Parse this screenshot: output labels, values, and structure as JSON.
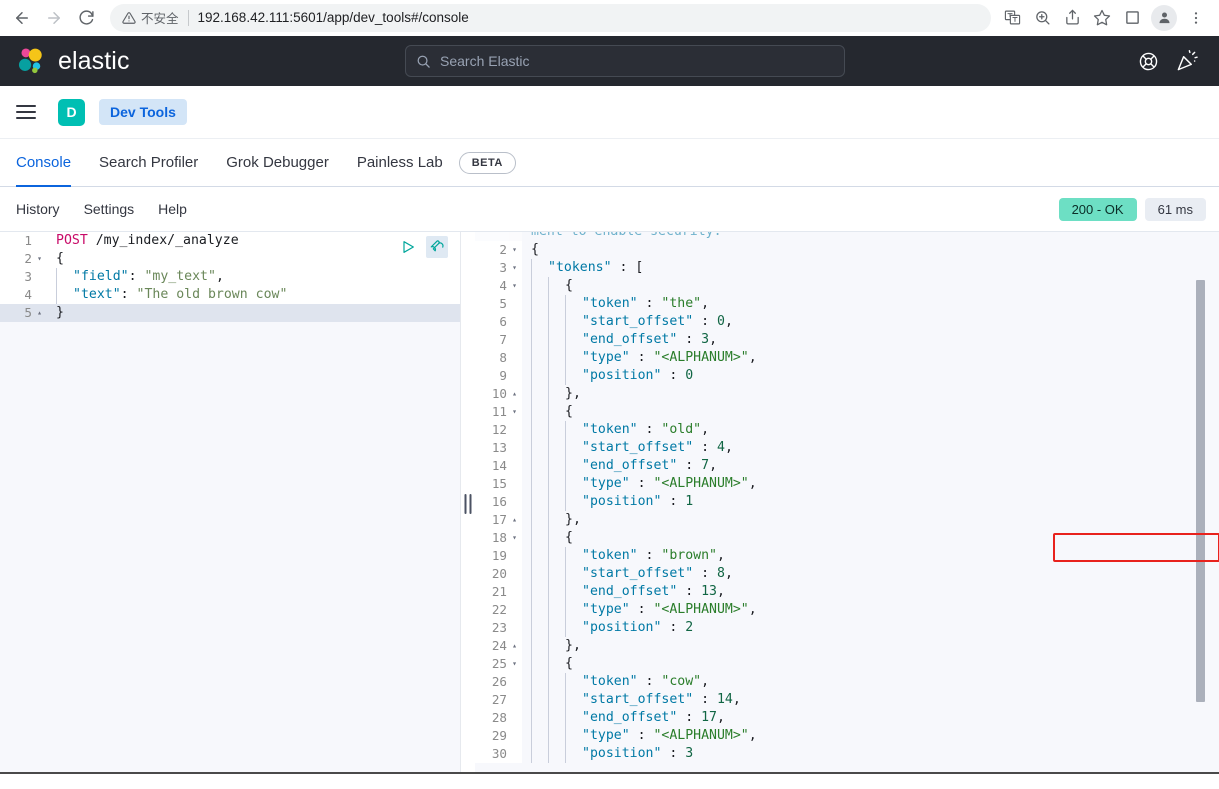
{
  "browser": {
    "back_label": "Back",
    "forward_label": "Forward",
    "reload_label": "Reload",
    "security_warning": "不安全",
    "url": "192.168.42.111:5601/app/dev_tools#/console",
    "toolbar_icons": [
      "translate-icon",
      "zoom-icon",
      "share-icon",
      "bookmark-star-icon",
      "sidepanel-icon",
      "profile-avatar-icon",
      "chrome-menu-icon"
    ]
  },
  "header": {
    "brand": "elastic",
    "search_placeholder": "Search Elastic",
    "search_icon": "search-icon",
    "help_icon": "help-lifebuoy-icon",
    "whats_new_icon": "announcement-megaphone-icon"
  },
  "breadcrumb": {
    "menu_icon": "hamburger-menu-icon",
    "space_initial": "D",
    "crumb": "Dev Tools"
  },
  "tabs": [
    {
      "label": "Console",
      "active": true
    },
    {
      "label": "Search Profiler",
      "active": false
    },
    {
      "label": "Grok Debugger",
      "active": false
    },
    {
      "label": "Painless Lab",
      "active": false
    }
  ],
  "beta_badge": "BETA",
  "console_toolbar": {
    "links": [
      "History",
      "Settings",
      "Help"
    ],
    "status": "200 - OK",
    "time": "61 ms"
  },
  "editor_actions": {
    "send_label": "Send request",
    "wrench_label": "Open documentation / actions"
  },
  "request_editor": {
    "lines": [
      {
        "n": "1",
        "fold": "",
        "active": false,
        "tokens": [
          {
            "t": "method",
            "v": "POST"
          },
          {
            "t": "plain",
            "v": " "
          },
          {
            "t": "url",
            "v": "/my_index/_analyze"
          }
        ]
      },
      {
        "n": "2",
        "fold": "▾",
        "active": false,
        "tokens": [
          {
            "t": "punct",
            "v": "{"
          }
        ]
      },
      {
        "n": "3",
        "fold": "",
        "active": false,
        "indent": 1,
        "tokens": [
          {
            "t": "key",
            "v": "\"field\""
          },
          {
            "t": "punct",
            "v": ": "
          },
          {
            "t": "str",
            "v": "\"my_text\""
          },
          {
            "t": "punct",
            "v": ","
          }
        ]
      },
      {
        "n": "4",
        "fold": "",
        "active": false,
        "indent": 1,
        "tokens": [
          {
            "t": "key",
            "v": "\"text\""
          },
          {
            "t": "punct",
            "v": ": "
          },
          {
            "t": "str",
            "v": "\"The old brown cow\""
          }
        ]
      },
      {
        "n": "5",
        "fold": "▴",
        "active": true,
        "tokens": [
          {
            "t": "punct",
            "v": "}"
          }
        ]
      }
    ]
  },
  "response_editor": {
    "truncated_top_text": "ment to enable security.",
    "lines": [
      {
        "n": "2",
        "fold": "▾",
        "tokens": [
          {
            "t": "punct",
            "v": "{"
          }
        ]
      },
      {
        "n": "3",
        "fold": "▾",
        "indent": 1,
        "tokens": [
          {
            "t": "key",
            "v": "\"tokens\""
          },
          {
            "t": "punct",
            "v": " : ["
          }
        ]
      },
      {
        "n": "4",
        "fold": "▾",
        "indent": 2,
        "tokens": [
          {
            "t": "punct",
            "v": "{"
          }
        ]
      },
      {
        "n": "5",
        "fold": "",
        "indent": 3,
        "tokens": [
          {
            "t": "key",
            "v": "\"token\""
          },
          {
            "t": "punct",
            "v": " : "
          },
          {
            "t": "strg",
            "v": "\"the\""
          },
          {
            "t": "punct",
            "v": ","
          }
        ]
      },
      {
        "n": "6",
        "fold": "",
        "indent": 3,
        "tokens": [
          {
            "t": "key",
            "v": "\"start_offset\""
          },
          {
            "t": "punct",
            "v": " : "
          },
          {
            "t": "num",
            "v": "0"
          },
          {
            "t": "punct",
            "v": ","
          }
        ]
      },
      {
        "n": "7",
        "fold": "",
        "indent": 3,
        "tokens": [
          {
            "t": "key",
            "v": "\"end_offset\""
          },
          {
            "t": "punct",
            "v": " : "
          },
          {
            "t": "num",
            "v": "3"
          },
          {
            "t": "punct",
            "v": ","
          }
        ]
      },
      {
        "n": "8",
        "fold": "",
        "indent": 3,
        "tokens": [
          {
            "t": "key",
            "v": "\"type\""
          },
          {
            "t": "punct",
            "v": " : "
          },
          {
            "t": "strg",
            "v": "\"<ALPHANUM>\""
          },
          {
            "t": "punct",
            "v": ","
          }
        ]
      },
      {
        "n": "9",
        "fold": "",
        "indent": 3,
        "tokens": [
          {
            "t": "key",
            "v": "\"position\""
          },
          {
            "t": "punct",
            "v": " : "
          },
          {
            "t": "num",
            "v": "0"
          }
        ]
      },
      {
        "n": "10",
        "fold": "▴",
        "indent": 2,
        "tokens": [
          {
            "t": "punct",
            "v": "},"
          }
        ]
      },
      {
        "n": "11",
        "fold": "▾",
        "indent": 2,
        "tokens": [
          {
            "t": "punct",
            "v": "{"
          }
        ]
      },
      {
        "n": "12",
        "fold": "",
        "indent": 3,
        "tokens": [
          {
            "t": "key",
            "v": "\"token\""
          },
          {
            "t": "punct",
            "v": " : "
          },
          {
            "t": "strg",
            "v": "\"old\""
          },
          {
            "t": "punct",
            "v": ","
          }
        ]
      },
      {
        "n": "13",
        "fold": "",
        "indent": 3,
        "tokens": [
          {
            "t": "key",
            "v": "\"start_offset\""
          },
          {
            "t": "punct",
            "v": " : "
          },
          {
            "t": "num",
            "v": "4"
          },
          {
            "t": "punct",
            "v": ","
          }
        ]
      },
      {
        "n": "14",
        "fold": "",
        "indent": 3,
        "tokens": [
          {
            "t": "key",
            "v": "\"end_offset\""
          },
          {
            "t": "punct",
            "v": " : "
          },
          {
            "t": "num",
            "v": "7"
          },
          {
            "t": "punct",
            "v": ","
          }
        ]
      },
      {
        "n": "15",
        "fold": "",
        "indent": 3,
        "tokens": [
          {
            "t": "key",
            "v": "\"type\""
          },
          {
            "t": "punct",
            "v": " : "
          },
          {
            "t": "strg",
            "v": "\"<ALPHANUM>\""
          },
          {
            "t": "punct",
            "v": ","
          }
        ]
      },
      {
        "n": "16",
        "fold": "",
        "indent": 3,
        "tokens": [
          {
            "t": "key",
            "v": "\"position\""
          },
          {
            "t": "punct",
            "v": " : "
          },
          {
            "t": "num",
            "v": "1"
          }
        ]
      },
      {
        "n": "17",
        "fold": "▴",
        "indent": 2,
        "tokens": [
          {
            "t": "punct",
            "v": "},"
          }
        ]
      },
      {
        "n": "18",
        "fold": "▾",
        "indent": 2,
        "tokens": [
          {
            "t": "punct",
            "v": "{"
          }
        ]
      },
      {
        "n": "19",
        "fold": "",
        "indent": 3,
        "tokens": [
          {
            "t": "key",
            "v": "\"token\""
          },
          {
            "t": "punct",
            "v": " : "
          },
          {
            "t": "strg",
            "v": "\"brown\""
          },
          {
            "t": "punct",
            "v": ","
          }
        ]
      },
      {
        "n": "20",
        "fold": "",
        "indent": 3,
        "tokens": [
          {
            "t": "key",
            "v": "\"start_offset\""
          },
          {
            "t": "punct",
            "v": " : "
          },
          {
            "t": "num",
            "v": "8"
          },
          {
            "t": "punct",
            "v": ","
          }
        ]
      },
      {
        "n": "21",
        "fold": "",
        "indent": 3,
        "tokens": [
          {
            "t": "key",
            "v": "\"end_offset\""
          },
          {
            "t": "punct",
            "v": " : "
          },
          {
            "t": "num",
            "v": "13"
          },
          {
            "t": "punct",
            "v": ","
          }
        ]
      },
      {
        "n": "22",
        "fold": "",
        "indent": 3,
        "tokens": [
          {
            "t": "key",
            "v": "\"type\""
          },
          {
            "t": "punct",
            "v": " : "
          },
          {
            "t": "strg",
            "v": "\"<ALPHANUM>\""
          },
          {
            "t": "punct",
            "v": ","
          }
        ]
      },
      {
        "n": "23",
        "fold": "",
        "indent": 3,
        "tokens": [
          {
            "t": "key",
            "v": "\"position\""
          },
          {
            "t": "punct",
            "v": " : "
          },
          {
            "t": "num",
            "v": "2"
          }
        ]
      },
      {
        "n": "24",
        "fold": "▴",
        "indent": 2,
        "tokens": [
          {
            "t": "punct",
            "v": "},"
          }
        ]
      },
      {
        "n": "25",
        "fold": "▾",
        "indent": 2,
        "tokens": [
          {
            "t": "punct",
            "v": "{"
          }
        ]
      },
      {
        "n": "26",
        "fold": "",
        "indent": 3,
        "tokens": [
          {
            "t": "key",
            "v": "\"token\""
          },
          {
            "t": "punct",
            "v": " : "
          },
          {
            "t": "strg",
            "v": "\"cow\""
          },
          {
            "t": "punct",
            "v": ","
          }
        ]
      },
      {
        "n": "27",
        "fold": "",
        "indent": 3,
        "tokens": [
          {
            "t": "key",
            "v": "\"start_offset\""
          },
          {
            "t": "punct",
            "v": " : "
          },
          {
            "t": "num",
            "v": "14"
          },
          {
            "t": "punct",
            "v": ","
          }
        ]
      },
      {
        "n": "28",
        "fold": "",
        "indent": 3,
        "tokens": [
          {
            "t": "key",
            "v": "\"end_offset\""
          },
          {
            "t": "punct",
            "v": " : "
          },
          {
            "t": "num",
            "v": "17"
          },
          {
            "t": "punct",
            "v": ","
          }
        ]
      },
      {
        "n": "29",
        "fold": "",
        "indent": 3,
        "tokens": [
          {
            "t": "key",
            "v": "\"type\""
          },
          {
            "t": "punct",
            "v": " : "
          },
          {
            "t": "strg",
            "v": "\"<ALPHANUM>\""
          },
          {
            "t": "punct",
            "v": ","
          }
        ]
      },
      {
        "n": "30",
        "fold": "",
        "indent": 3,
        "tokens": [
          {
            "t": "key",
            "v": "\"position\""
          },
          {
            "t": "punct",
            "v": " : "
          },
          {
            "t": "num",
            "v": "3"
          }
        ]
      }
    ]
  },
  "annotation": {
    "shape": "red-rectangle-highlight",
    "target": "\"token\" : \"the\","
  },
  "colors": {
    "elastic_dark": "#25282f",
    "accent_blue": "#0b64dd",
    "teal": "#00bfb3",
    "status_green": "#6ddfc4",
    "annotation_red": "#e8221d"
  }
}
